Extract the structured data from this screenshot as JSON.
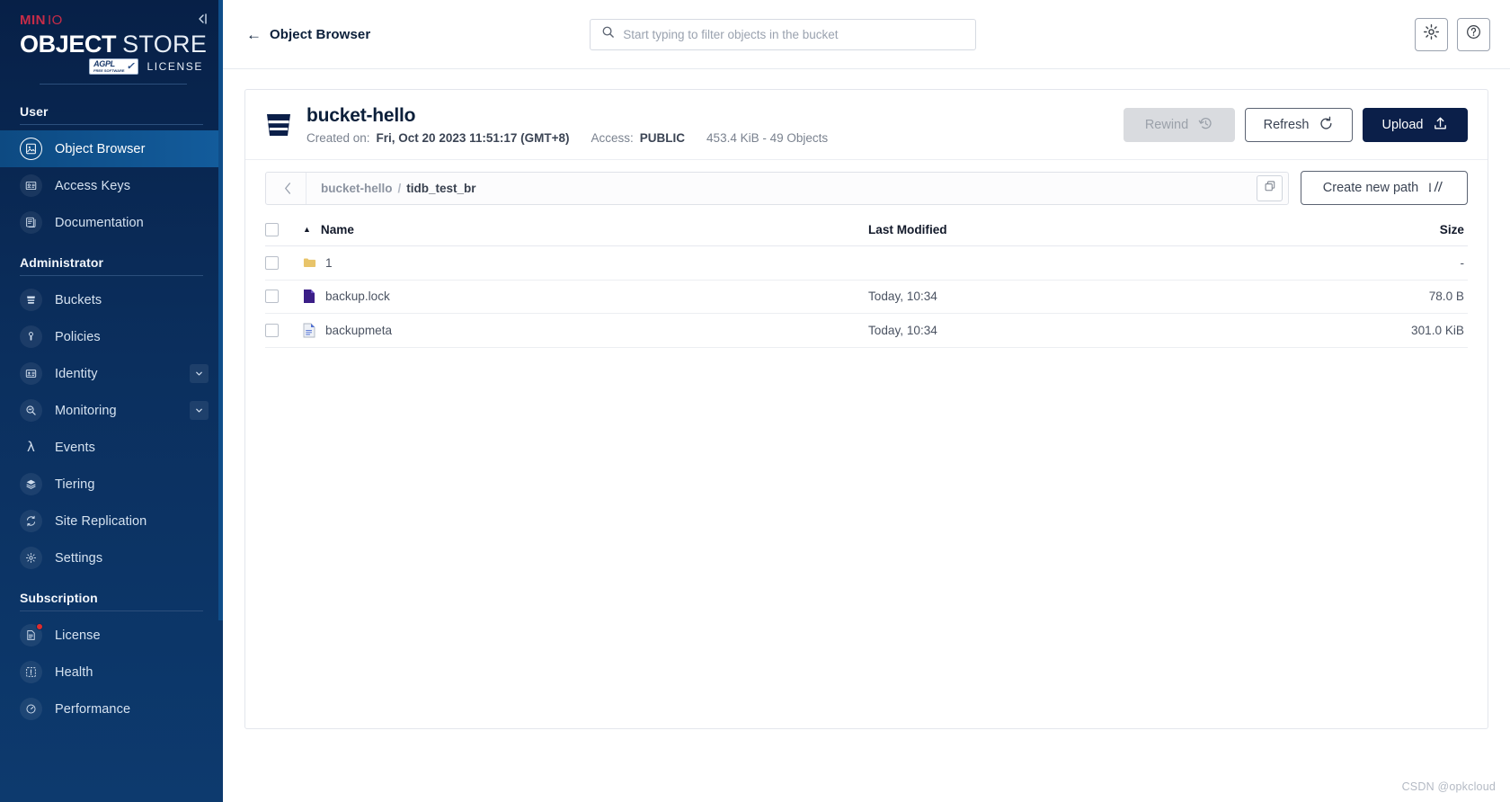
{
  "sidebar": {
    "logo": {
      "minio_bold": "MIN",
      "minio_light": "IO",
      "object": "OBJECT",
      "store": "STORE",
      "agpl": "AGPL",
      "agpl_sub": "FREE SOFTWARE",
      "license": "LICENSE",
      "collapse_icon": "collapse-panel-icon"
    },
    "sections": [
      {
        "title": "User",
        "items": [
          {
            "label": "Object Browser",
            "icon": "object-browser-icon",
            "active": true,
            "caret": false,
            "badge": false
          },
          {
            "label": "Access Keys",
            "icon": "access-keys-icon",
            "active": false,
            "caret": false,
            "badge": false
          },
          {
            "label": "Documentation",
            "icon": "documentation-icon",
            "active": false,
            "caret": false,
            "badge": false
          }
        ]
      },
      {
        "title": "Administrator",
        "items": [
          {
            "label": "Buckets",
            "icon": "bucket-icon",
            "active": false,
            "caret": false,
            "badge": false
          },
          {
            "label": "Policies",
            "icon": "policies-icon",
            "active": false,
            "caret": false,
            "badge": false
          },
          {
            "label": "Identity",
            "icon": "identity-icon",
            "active": false,
            "caret": true,
            "badge": false
          },
          {
            "label": "Monitoring",
            "icon": "monitoring-icon",
            "active": false,
            "caret": true,
            "badge": false
          },
          {
            "label": "Events",
            "icon": "events-lambda-icon",
            "active": false,
            "caret": false,
            "badge": false
          },
          {
            "label": "Tiering",
            "icon": "tiering-layers-icon",
            "active": false,
            "caret": false,
            "badge": false
          },
          {
            "label": "Site Replication",
            "icon": "site-replication-icon",
            "active": false,
            "caret": false,
            "badge": false
          },
          {
            "label": "Settings",
            "icon": "settings-gear-icon",
            "active": false,
            "caret": false,
            "badge": false
          }
        ]
      },
      {
        "title": "Subscription",
        "items": [
          {
            "label": "License",
            "icon": "license-doc-icon",
            "active": false,
            "caret": false,
            "badge": true
          },
          {
            "label": "Health",
            "icon": "health-icon",
            "active": false,
            "caret": false,
            "badge": false
          },
          {
            "label": "Performance",
            "icon": "performance-icon",
            "active": false,
            "caret": false,
            "badge": false
          }
        ]
      }
    ]
  },
  "topbar": {
    "back_label": "Object Browser",
    "back_icon": "arrow-left-icon",
    "search_placeholder": "Start typing to filter objects in the bucket",
    "search_value": "",
    "search_icon": "search-icon",
    "settings_icon": "gear-icon",
    "help_icon": "help-circle-icon"
  },
  "bucket": {
    "icon": "bucket-icon",
    "name": "bucket-hello",
    "created_label": "Created on:",
    "created_value": "Fri, Oct 20 2023 11:51:17 (GMT+8)",
    "access_label": "Access:",
    "access_value": "PUBLIC",
    "size_objects": "453.4 KiB - 49 Objects",
    "actions": {
      "rewind": "Rewind",
      "rewind_icon": "rewind-clock-icon",
      "refresh": "Refresh",
      "refresh_icon": "refresh-icon",
      "upload": "Upload",
      "upload_icon": "upload-icon"
    }
  },
  "path": {
    "back_icon": "chevron-left-icon",
    "crumbs": [
      "bucket-hello",
      "tidb_test_br"
    ],
    "separator": "/",
    "copy_icon": "copy-icon",
    "create_new_path": "Create new path",
    "create_new_path_icon": "new-path-icon"
  },
  "table": {
    "columns": {
      "name": "Name",
      "last_modified": "Last Modified",
      "size": "Size"
    },
    "sort_icon": "sort-asc-caret-icon",
    "rows": [
      {
        "icon": "folder-icon",
        "name": "1",
        "last_modified": "",
        "size": "-"
      },
      {
        "icon": "file-lock-icon",
        "name": "backup.lock",
        "last_modified": "Today, 10:34",
        "size": "78.0 B"
      },
      {
        "icon": "file-meta-icon",
        "name": "backupmeta",
        "last_modified": "Today, 10:34",
        "size": "301.0 KiB"
      }
    ]
  },
  "watermark": "CSDN @opkcloud",
  "colors": {
    "sidebar_top": "#072047",
    "sidebar_bottom": "#0d3a6e",
    "active_nav": "#135c9c",
    "brand_red": "#C72C48",
    "primary_button": "#0b1f49",
    "folder": "#E8C46A",
    "lock_file": "#3B1E87"
  }
}
